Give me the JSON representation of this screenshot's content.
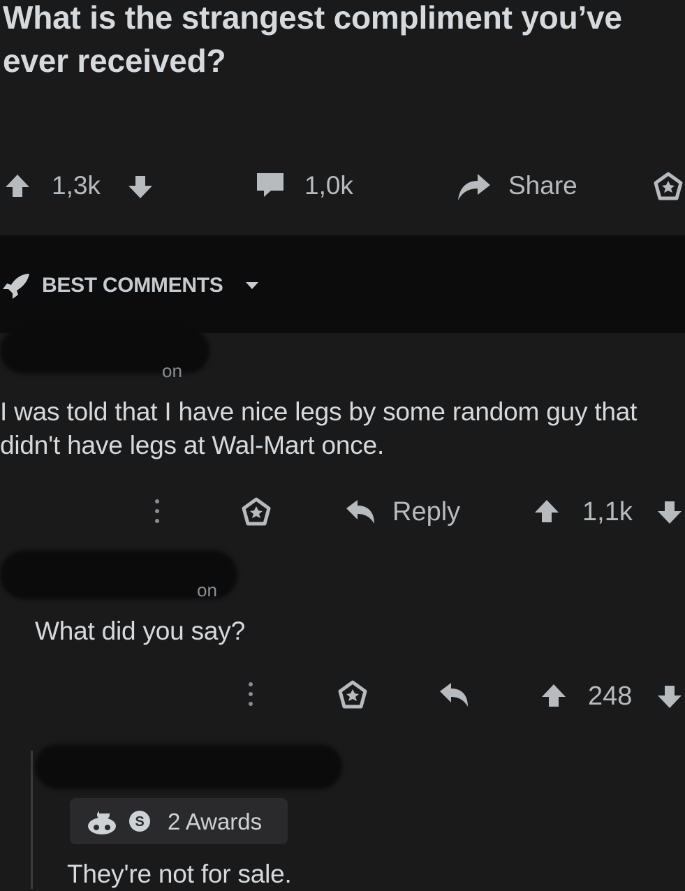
{
  "post": {
    "title": "What is the strangest compliment you’ve ever received?",
    "score": "1,3k",
    "comments": "1,0k",
    "share_label": "Share"
  },
  "sort": {
    "label": "BEST COMMENTS"
  },
  "comments": [
    {
      "meta_fragment": "on",
      "body": "I was told that I have nice legs by some random guy that didn't have legs at Wal-Mart once.",
      "reply_label": "Reply",
      "score": "1,1k"
    },
    {
      "meta_fragment": "on",
      "body": "What did you say?",
      "score": "248"
    },
    {
      "awards": "2 Awards",
      "body": "They're not for sale."
    }
  ],
  "colors": {
    "background": "#1a1a1b",
    "band": "#0c0c0d",
    "text": "#d7dadc",
    "muted": "#b8bbbe"
  },
  "icons": [
    "upvote-icon",
    "downvote-icon",
    "comment-icon",
    "share-icon",
    "award-icon",
    "rocket-icon",
    "caret-down-icon",
    "more-icon",
    "reply-icon"
  ]
}
